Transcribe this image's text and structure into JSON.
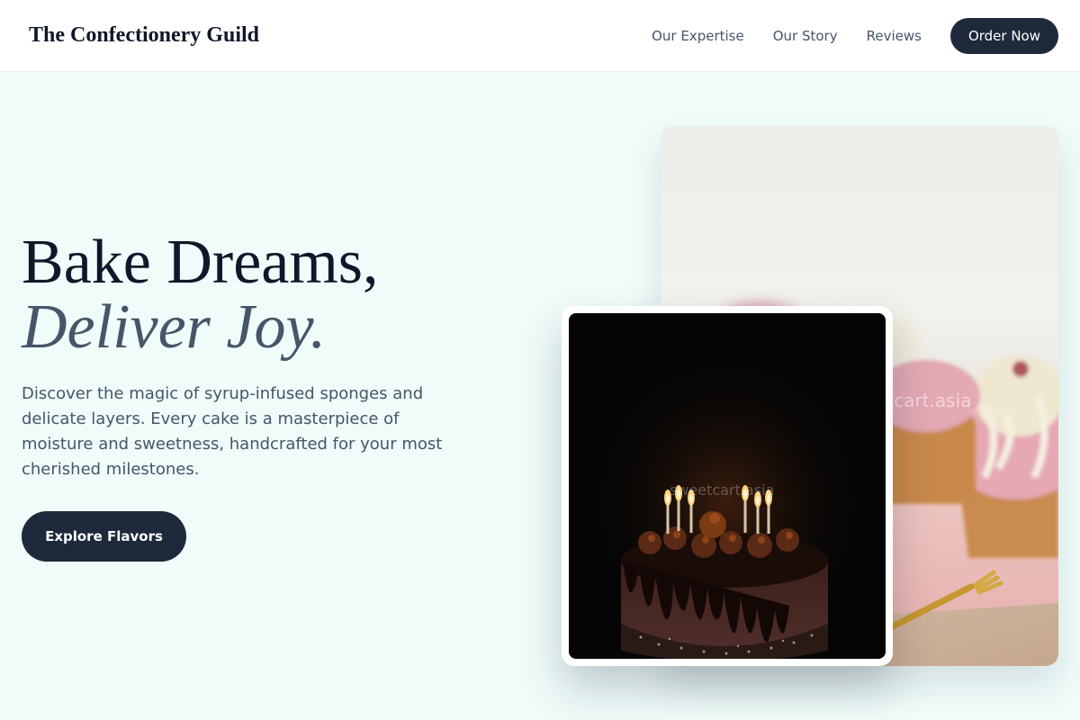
{
  "nav": {
    "brand": "The Confectionery Guild",
    "links": [
      "Our Expertise",
      "Our Story",
      "Reviews"
    ],
    "cta": "Order Now"
  },
  "hero": {
    "headline_line1": "Bake Dreams,",
    "headline_line2": "Deliver Joy.",
    "description": "Discover the magic of syrup-infused sponges and delicate layers. Every cake is a masterpiece of moisture and sweetness, handcrafted for your most cherished milestones.",
    "cta": "Explore Flavors"
  },
  "images": {
    "back_watermark": "sweetcart.asia",
    "front_watermark": "sweetcart.asia"
  },
  "colors": {
    "page_background": "#effcfa",
    "button_dark": "#1e293b",
    "heading": "#0f172a",
    "body_text": "#475569"
  }
}
